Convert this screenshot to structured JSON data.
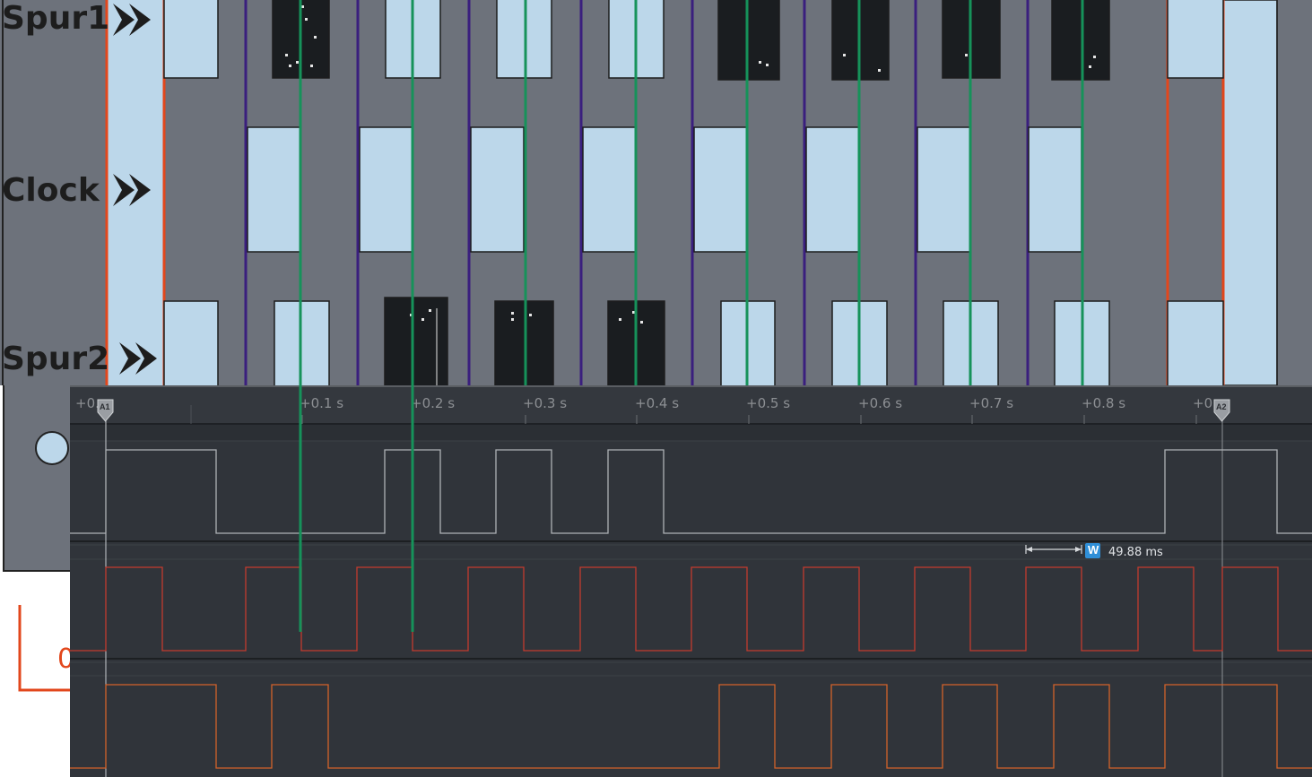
{
  "labels": {
    "spur1": "Spur1",
    "clock": "Clock",
    "spur2": "Spur2"
  },
  "analyzer": {
    "timeline": {
      "start_label": "+0.",
      "end_label": "+0.",
      "ticks": [
        "+0.1 s",
        "+0.2 s",
        "+0.3 s",
        "+0.4 s",
        "+0.5 s",
        "+0.6 s",
        "+0.7 s",
        "+0.8 s"
      ]
    },
    "markers": [
      {
        "id": "A1",
        "label": "A1"
      },
      {
        "id": "A2",
        "label": "A2"
      }
    ],
    "measurement": {
      "icon": "W",
      "value": "49.88 ms"
    },
    "channels": [
      {
        "name": "Spur1",
        "color": "#aeb2b6"
      },
      {
        "name": "Clock",
        "color": "#c23a2e"
      },
      {
        "name": "Spur2",
        "color": "#d2622a"
      }
    ]
  },
  "colors": {
    "panel_background": "#6d727b",
    "block_light": "#bcd7ea",
    "block_dark": "#1a1d20",
    "cursor_orange": "#e2471c",
    "cursor_purple": "#3a1f7e",
    "cursor_green": "#16925a",
    "analyzer_background": "#30343a"
  }
}
